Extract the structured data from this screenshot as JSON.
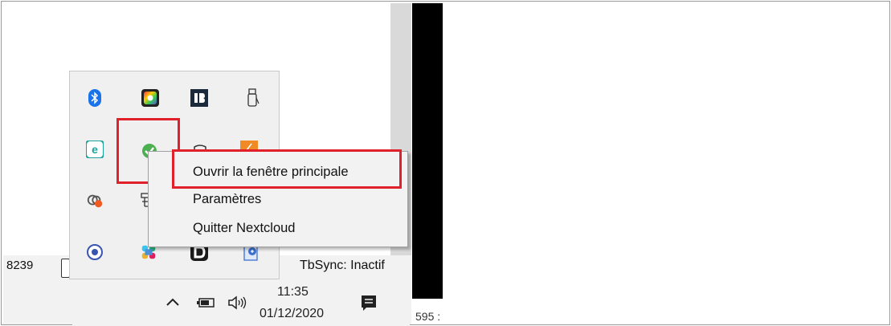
{
  "context_menu": {
    "items": [
      {
        "label": "Ouvrir la fenêtre principale"
      },
      {
        "label": "Paramètres"
      },
      {
        "label": "Quitter Nextcloud"
      }
    ]
  },
  "statusbar": {
    "left_value": "8239",
    "right_text": "TbSync: Inactif",
    "secondary_value": "595 :"
  },
  "taskbar": {
    "time": "11:35",
    "date": "01/12/2020"
  },
  "colors": {
    "highlight": "#e0202a",
    "nextcloud_green": "#4caf50",
    "bluetooth_blue": "#1a73e8"
  }
}
